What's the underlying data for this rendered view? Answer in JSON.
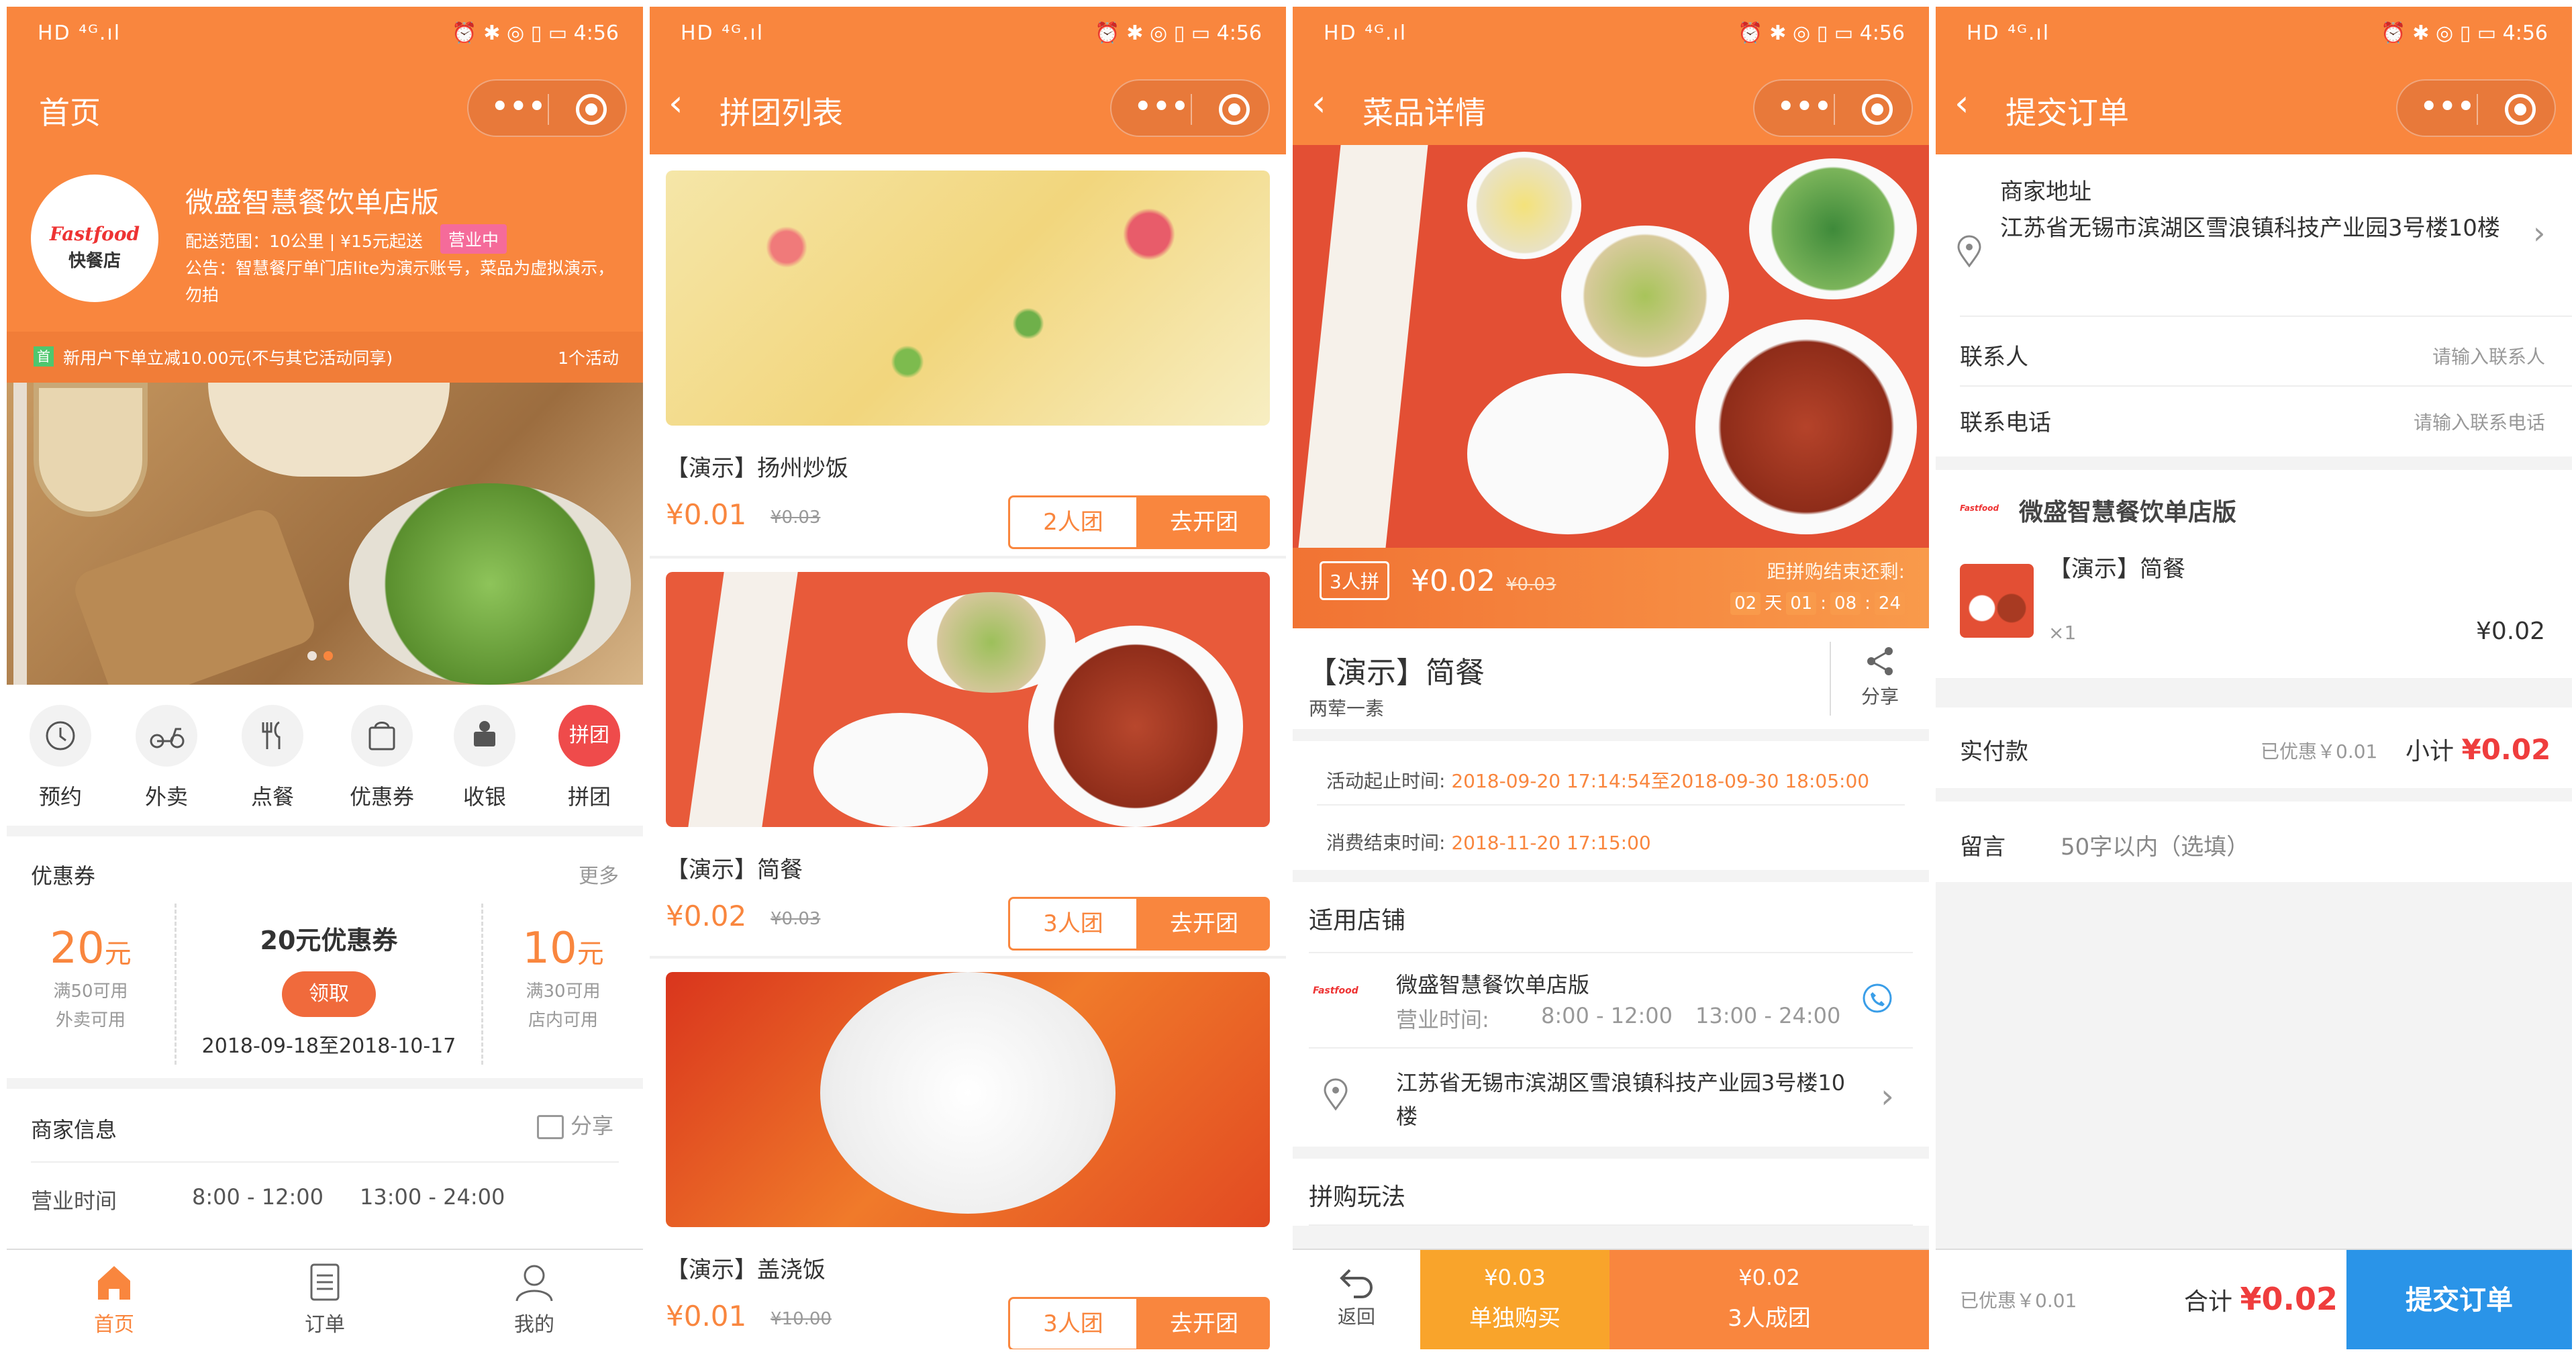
{
  "status": {
    "left": "HD ⁴ᴳ.ıl",
    "right": "⏰ ✱ ◎ ▯ ▭ 4:56"
  },
  "s1": {
    "title": "首页",
    "logo_text1": "Fastfood",
    "logo_text2": "快餐店",
    "store_name": "微盛智慧餐饮单店版",
    "delivery": "配送范围：10公里 | ¥15元起送",
    "status_badge": "营业中",
    "notice": "公告：智慧餐厅单门店lite为演示账号，菜品为虚拟演示，勿拍",
    "promo_tag": "首",
    "promo": "新用户下单立减10.00元(不与其它活动同享)",
    "promo_count": "1个活动",
    "icons": [
      {
        "label": "预约",
        "icon": "clock-icon"
      },
      {
        "label": "外卖",
        "icon": "scooter-icon"
      },
      {
        "label": "点餐",
        "icon": "fork-knife-icon"
      },
      {
        "label": "优惠券",
        "icon": "coupon-bag-icon"
      },
      {
        "label": "收银",
        "icon": "cashier-icon"
      },
      {
        "label": "拼团",
        "icon": "group-buy-icon"
      }
    ],
    "group_badge": "拼团",
    "coupon_title": "优惠券",
    "coupon_more": "更多",
    "coupons": [
      {
        "amount": "20",
        "unit": "元",
        "cond": "满50可用",
        "scope": "外卖可用"
      },
      {
        "amount": "10",
        "unit": "元",
        "cond": "满30可用",
        "scope": "店内可用"
      }
    ],
    "coupon_center": {
      "name": "20元优惠券",
      "btn": "领取",
      "date": "2018-09-18至2018-10-17"
    },
    "merchant_title": "商家信息",
    "share": "分享",
    "hours_label": "营业时间",
    "hours1": "8:00 - 12:00",
    "hours2": "13:00 - 24:00",
    "tabs": [
      {
        "label": "首页",
        "icon": "home-icon"
      },
      {
        "label": "订单",
        "icon": "order-icon"
      },
      {
        "label": "我的",
        "icon": "user-icon"
      }
    ]
  },
  "s2": {
    "title": "拼团列表",
    "items": [
      {
        "name": "【演示】扬州炒饭",
        "price": "¥0.01",
        "orig": "¥0.03",
        "group": "2人团",
        "btn": "去开团",
        "img": "fried-rice-image"
      },
      {
        "name": "【演示】简餐",
        "price": "¥0.02",
        "orig": "¥0.03",
        "group": "3人团",
        "btn": "去开团",
        "img": "set-meal-image"
      },
      {
        "name": "【演示】盖浇饭",
        "price": "¥0.01",
        "orig": "¥10.00",
        "group": "3人团",
        "btn": "去开团",
        "img": "rice-bowl-image"
      }
    ]
  },
  "s3": {
    "title": "菜品详情",
    "tag": "3人拼",
    "price": "¥0.02",
    "orig": "¥0.03",
    "countdown_label": "距拼购结束还剩:",
    "cd": [
      "02",
      "天",
      "01",
      ":",
      "08",
      ":",
      "24"
    ],
    "dish_name": "【演示】简餐",
    "dish_desc": "两荤一素",
    "share": "分享",
    "time1_label": "活动起止时间:",
    "time1": "2018-09-20 17:14:54至2018-09-30 18:05:00",
    "time2_label": "消费结束时间:",
    "time2": "2018-11-20 17:15:00",
    "store_section": "适用店铺",
    "store_name": "微盛智慧餐饮单店版",
    "hours_label": "营业时间:",
    "hours1": "8:00 - 12:00",
    "hours2": "13:00 - 24:00",
    "address": "江苏省无锡市滨湖区雪浪镇科技产业园3号楼10楼",
    "play_section": "拼购玩法",
    "back": "返回",
    "single_price": "¥0.03",
    "single_label": "单独购买",
    "group_price": "¥0.02",
    "group_label": "3人成团"
  },
  "s4": {
    "title": "提交订单",
    "addr_label": "商家地址",
    "address": "江苏省无锡市滨湖区雪浪镇科技产业园3号楼10楼",
    "contact_label": "联系人",
    "contact_ph": "请输入联系人",
    "phone_label": "联系电话",
    "phone_ph": "请输入联系电话",
    "store_name": "微盛智慧餐饮单店版",
    "item_name": "【演示】简餐",
    "qty": "×1",
    "item_price": "¥0.02",
    "pay_label": "实付款",
    "discount": "已优惠￥0.01",
    "subtotal_label": "小计",
    "subtotal": "¥0.02",
    "remark_label": "留言",
    "remark_ph": "50字以内（选填）",
    "bottom_discount": "已优惠￥0.01",
    "total_label": "合计",
    "total": "¥0.02",
    "submit": "提交订单"
  }
}
